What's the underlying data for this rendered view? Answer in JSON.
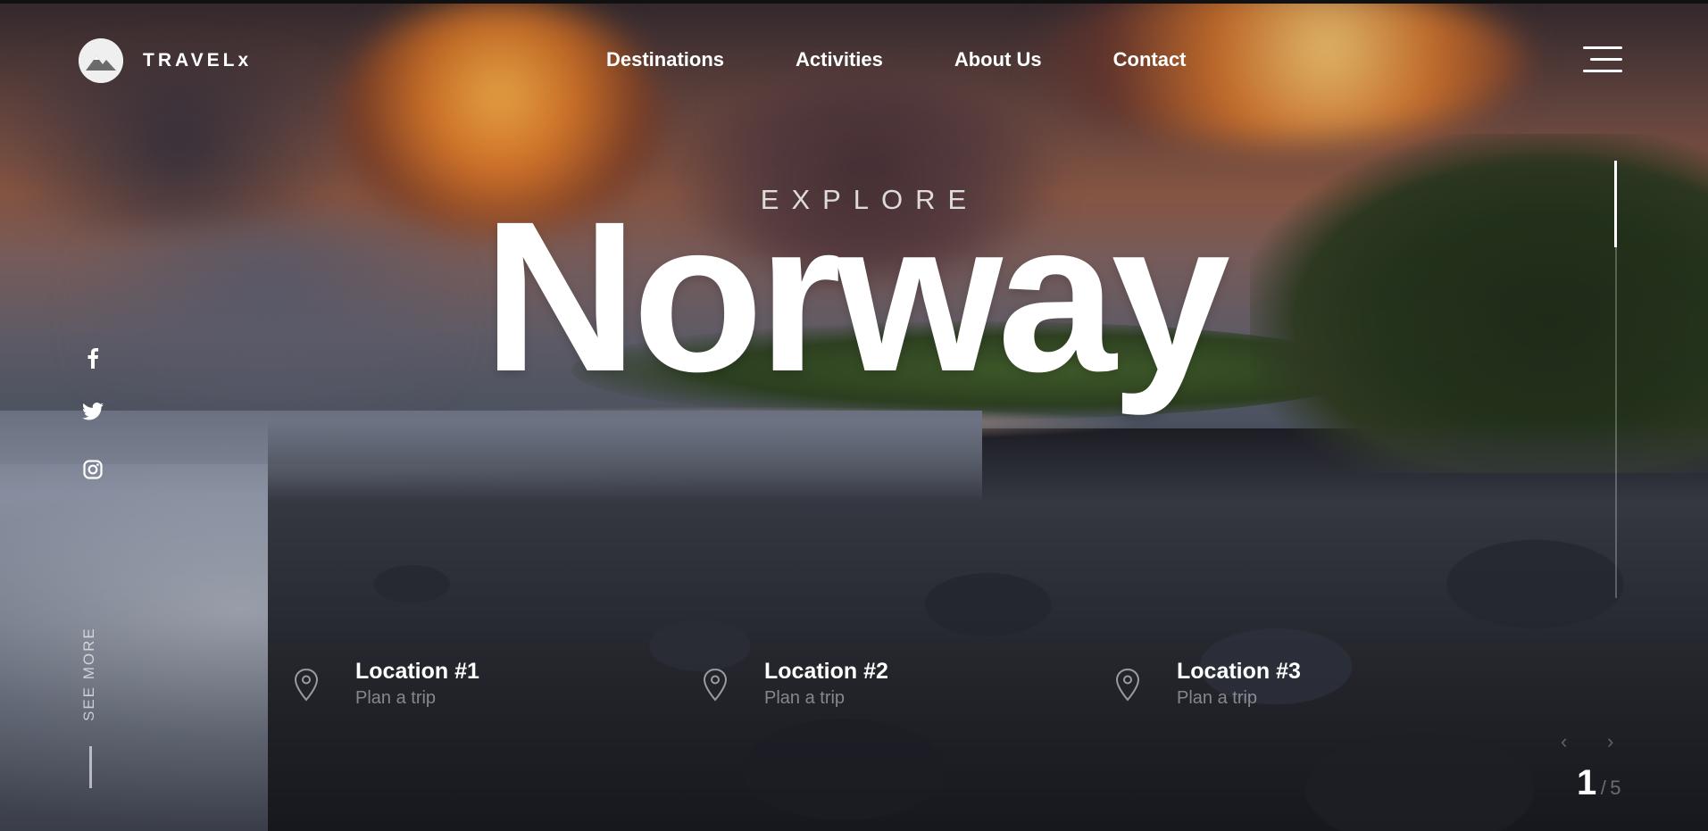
{
  "brand": {
    "name": "TRAVELx",
    "logo_icon": "mountain-icon"
  },
  "nav": {
    "items": [
      {
        "label": "Destinations"
      },
      {
        "label": "Activities"
      },
      {
        "label": "About Us"
      },
      {
        "label": "Contact"
      }
    ],
    "menu_icon": "hamburger-menu-icon"
  },
  "hero": {
    "eyebrow": "EXPLORE",
    "title": "Norway"
  },
  "social": [
    {
      "icon": "facebook-icon"
    },
    {
      "icon": "twitter-icon"
    },
    {
      "icon": "instagram-icon"
    }
  ],
  "see_more": {
    "label": "SEE MORE"
  },
  "locations": [
    {
      "title": "Location #1",
      "subtitle": "Plan a trip",
      "icon": "map-pin-icon"
    },
    {
      "title": "Location #2",
      "subtitle": "Plan a trip",
      "icon": "map-pin-icon"
    },
    {
      "title": "Location #3",
      "subtitle": "Plan a trip",
      "icon": "map-pin-icon"
    }
  ],
  "slider": {
    "current": "1",
    "total": "5",
    "separator": "/",
    "prev_icon": "chevron-left-icon",
    "next_icon": "chevron-right-icon"
  },
  "colors": {
    "text": "#ffffff",
    "muted": "#b3b3b3"
  }
}
